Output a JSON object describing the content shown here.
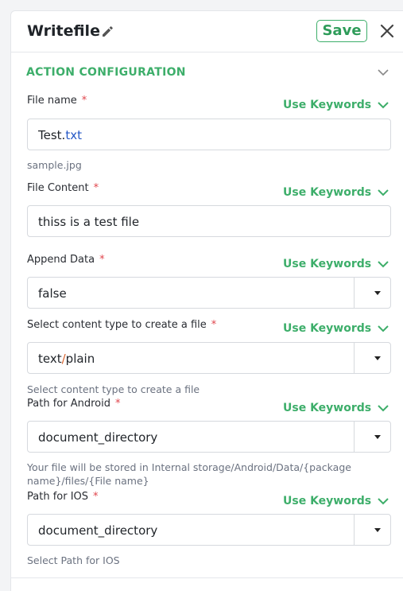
{
  "header": {
    "title": "Writefile",
    "save_label": "Save"
  },
  "section": {
    "title": "ACTION CONFIGURATION"
  },
  "keywords_label": "Use Keywords",
  "required_mark": "*",
  "fields": {
    "file_name": {
      "label": "File name",
      "value_prefix": "Test.",
      "value_ext": "txt",
      "hint": "sample.jpg"
    },
    "file_content": {
      "label": "File Content",
      "value": "thiss is a test file"
    },
    "append_data": {
      "label": "Append Data",
      "value": "false"
    },
    "content_type": {
      "label": "Select content type to create a file",
      "value_part1": "text",
      "value_slash": "/",
      "value_part2": "plain",
      "hint": "Select content type to create a file"
    },
    "path_android": {
      "label": "Path for Android",
      "value": "document_directory",
      "hint": "Your file will be stored in Internal storage/Android/Data/{package name}/files/{File name}"
    },
    "path_ios": {
      "label": "Path for IOS",
      "value": "document_directory",
      "hint": "Select Path for IOS"
    }
  },
  "colors": {
    "accent_green": "#3dae6a",
    "required_red": "#e0454c",
    "extension_blue": "#2457c5",
    "slash_orange": "#d9622b"
  }
}
